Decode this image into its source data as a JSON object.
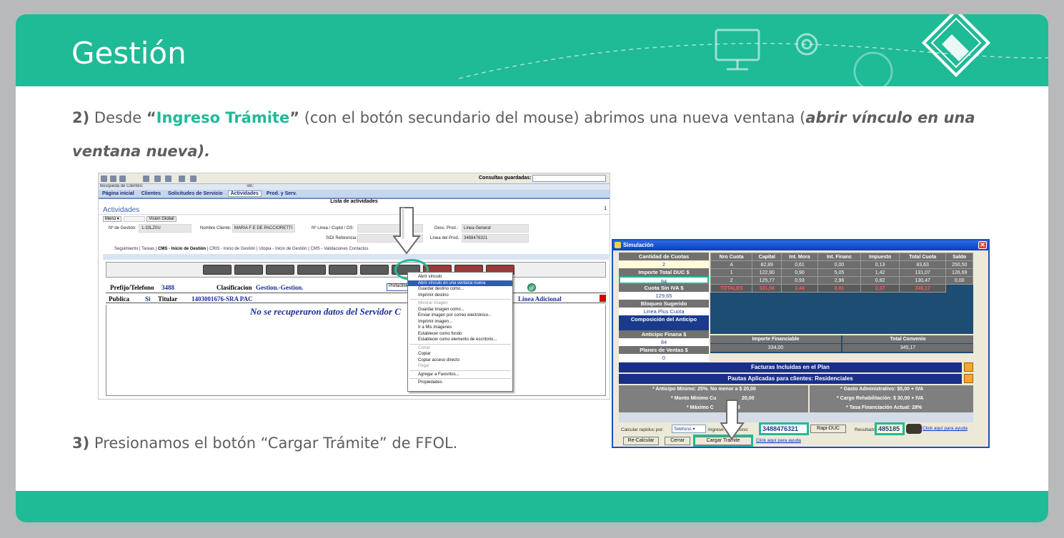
{
  "header": {
    "title": "Gestión"
  },
  "step2": {
    "num": "2)",
    "text_a": " Desde ",
    "quote_open": "“",
    "link": "Ingreso Trámite",
    "quote_close": "”",
    "text_b": " (con el botón secundario del mouse) abrimos una nueva ventana (",
    "emph_a": "abrir vínculo en una",
    "emph_b": "ventana nueva)."
  },
  "step3": {
    "num": "3)",
    "text": " Presionamos el botón “Cargar Trámite” de FFOL."
  },
  "crm": {
    "consultas_label": "Consultas guardadas:",
    "breadcrumb": "Búsqueda de Clientes:",
    "breadcrumb_tail": "ión:",
    "tabs": [
      "Página inicial",
      "Clientes",
      "Solicitudes de Servicio",
      "Actividades",
      "Prod. y Serv."
    ],
    "list_title": "Lista de actividades",
    "section": "Actividades",
    "menu": "Menú ▾",
    "vision": "Vision Global",
    "page_num": "1",
    "fields": {
      "n_gestion_label": "Nº de Gestión:",
      "n_gestion": "1-33LZ0U",
      "cliente_label": "Nombre Cliente:",
      "cliente": "MARIA F E DE PACCIORETTI",
      "linea_label": "Nº Linea / CupId / OS:",
      "sidi_label": "SIDI Referencia:",
      "desc_label": "Desc. Prod.:",
      "desc": "Linea General",
      "lineaprod_label": "Linea del Prod.:",
      "lineaprod": "3488476321"
    },
    "subtabs": [
      "Seguimiento",
      "Tareas",
      "CMS - Inicio de Gestión",
      "CRIS - Inicio de Gestión",
      "Utopia - Inicio de Gestión",
      "CMS - Validaciones Contactos"
    ],
    "prefijo_label": "Prefijo/Telefono",
    "prefijo": "3488",
    "clasif_label": "Clasificacion",
    "clasif": "Gestion.-Gestion.",
    "prefact": "Prefactible",
    "pub_cols": [
      "Publica",
      "Si",
      "Titular",
      "1403001676-SRA PAC"
    ],
    "linea_adic": "Linea Adicional",
    "no_data": "No se recuperaron datos del Servidor C",
    "context_menu": [
      {
        "label": "Abrir vínculo",
        "state": "normal"
      },
      {
        "label": "Abrir vínculo en una ventana nueva",
        "state": "highlight"
      },
      {
        "label": "Guardar destino como...",
        "state": "normal"
      },
      {
        "label": "Imprimir destino",
        "state": "normal"
      },
      {
        "label": "",
        "state": "sep"
      },
      {
        "label": "Mostrar imagen",
        "state": "disabled"
      },
      {
        "label": "Guardar imagen como...",
        "state": "normal"
      },
      {
        "label": "Enviar imagen por correo electrónico...",
        "state": "normal"
      },
      {
        "label": "Imprimir imagen...",
        "state": "normal"
      },
      {
        "label": "Ir a Mis imágenes",
        "state": "normal"
      },
      {
        "label": "Establecer como fondo",
        "state": "normal"
      },
      {
        "label": "Establecer como elemento de escritorio...",
        "state": "normal"
      },
      {
        "label": "",
        "state": "sep"
      },
      {
        "label": "Cortar",
        "state": "disabled"
      },
      {
        "label": "Copiar",
        "state": "normal"
      },
      {
        "label": "Copiar acceso directo",
        "state": "normal"
      },
      {
        "label": "Pegar",
        "state": "disabled"
      },
      {
        "label": "",
        "state": "sep"
      },
      {
        "label": "Agregar a Favoritos...",
        "state": "normal"
      },
      {
        "label": "",
        "state": "sep"
      },
      {
        "label": "Propiedades",
        "state": "normal"
      }
    ]
  },
  "sim": {
    "title": "Simulación",
    "left": [
      {
        "label": "Cantidad de Cuotas",
        "value": "2",
        "yellow": true
      },
      {
        "label": "Importe Total DUC $",
        "value": "84",
        "yellow": false
      },
      {
        "label": "Cuota Sin IVA $",
        "value": "129,65",
        "yellow": false
      },
      {
        "label": "Bloqueo Sugerido",
        "value": "Linea Plus Cuota",
        "yellow": false
      }
    ],
    "comp_title": "Composición del Anticipo",
    "left2": [
      {
        "label": "Anticipo Finana $",
        "value": "84"
      },
      {
        "label": "Planes de Ventas $",
        "value": "0"
      }
    ],
    "grid_headers": [
      "Nro Cuota",
      "Capital",
      "Int. Mora",
      "Int. Financ",
      "Impuesto",
      "Total Cuota",
      "Saldo"
    ],
    "grid_rows": [
      [
        "A",
        "82,89",
        "0,61",
        "0,00",
        "0,13",
        "83,63",
        "250,50"
      ],
      [
        "1",
        "122,90",
        "0,90",
        "5,05",
        "1,42",
        "131,07",
        "126,69"
      ],
      [
        "2",
        "125,77",
        "0,93",
        "2,96",
        "0,82",
        "130,47",
        "0,00"
      ]
    ],
    "grid_totals": [
      "TOTALES",
      "331,56",
      "2,44",
      "8,81",
      "2,37",
      "345,17"
    ],
    "fin_label": "Importe Financiable",
    "fin_value": "334,00",
    "conv_label": "Total Convenio",
    "conv_value": "345,17",
    "facturas": "Facturas Incluidas en el Plan",
    "pautas_title": "Pautas Aplicadas para clientes: Residenciales",
    "pautas": [
      "* Anticipo Mínimo: 25%. No menor a $ 20,00",
      "* Gasto Administrativo: $5,00 + IVA",
      "* Monto Mínimo Cu",
      "20,00",
      "* Cargo Rehabilitación: $ 30,00 + IVA",
      "* Máximo C",
      "6",
      "* Tasa Financiación Actual: 28%"
    ],
    "calc_label": "Calcular rapiduc por:",
    "calc_sel": "Teléfono",
    "ingrese_label": "Ingrese el Teléfono:",
    "phone": "3488476321",
    "rapiduc": "Rapi-DUC",
    "resultado_label": "Resultado:",
    "resultado": "485185",
    "ayuda": "Click aquí para ayuda",
    "recalcular": "Re-Calcular",
    "cerrar": "Cerrar",
    "cargar": "Cargar Tramite",
    "ayuda2": "Click aquí para ayuda"
  },
  "colors": {
    "brand": "#1fba96",
    "bg": "#b7b9bb"
  }
}
